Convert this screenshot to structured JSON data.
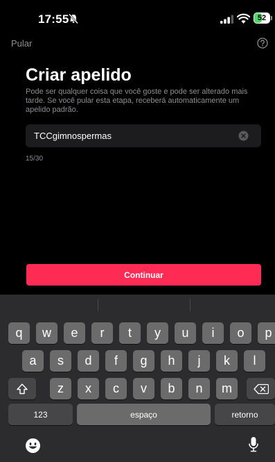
{
  "status_bar": {
    "time": "17:55",
    "battery_level": 52,
    "battery_label": "52",
    "icons": [
      "bell-slash-icon",
      "signal-icon",
      "wifi-icon",
      "battery-icon"
    ],
    "battery_color": "#4cd964"
  },
  "nav": {
    "skip_label": "Pular",
    "help_icon": "question-circle-icon"
  },
  "content": {
    "title": "Criar apelido",
    "description": "Pode ser qualquer coisa que você goste e pode ser alterado mais tarde. Se você pular esta etapa, receberá automaticamente um apelido padrão.",
    "nickname_value": "TCCgimnospermas",
    "char_count": "15/30"
  },
  "actions": {
    "continue_label": "Continuar",
    "accent_color": "#fe2c55"
  },
  "keyboard": {
    "row1": [
      "q",
      "w",
      "e",
      "r",
      "t",
      "y",
      "u",
      "i",
      "o",
      "p"
    ],
    "row2": [
      "a",
      "s",
      "d",
      "f",
      "g",
      "h",
      "j",
      "k",
      "l"
    ],
    "row3": [
      "z",
      "x",
      "c",
      "v",
      "b",
      "n",
      "m"
    ],
    "numbers_label": "123",
    "space_label": "espaço",
    "return_label": "retorno",
    "icons": [
      "shift-icon",
      "backspace-icon",
      "emoji-icon",
      "microphone-icon"
    ]
  }
}
